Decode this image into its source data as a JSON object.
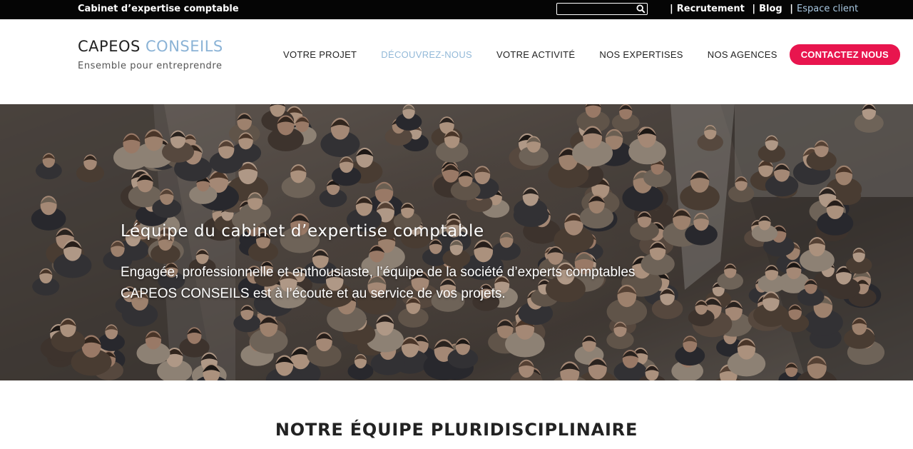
{
  "topbar": {
    "tagline": "Cabinet d’expertise comptable",
    "search": {
      "placeholder": ""
    },
    "links": [
      {
        "label": "Recrutement"
      },
      {
        "label": "Blog"
      },
      {
        "label": "Espace client"
      }
    ],
    "separator": "|"
  },
  "header": {
    "logo_part1": "CAPEOS",
    "logo_part2": "CONSEILS",
    "logo_tagline": "Ensemble pour entreprendre",
    "nav": [
      {
        "label": "VOTRE PROJET"
      },
      {
        "label": "DÉCOUVREZ-NOUS",
        "active": true
      },
      {
        "label": "VOTRE ACTIVITÉ"
      },
      {
        "label": "NOS EXPERTISES"
      },
      {
        "label": "NOS AGENCES"
      }
    ],
    "cta_label": "CONTACTEZ NOUS"
  },
  "hero": {
    "title": "Léquipe du cabinet d’expertise comptable",
    "text": "Engagée, professionnelle et enthousiaste, l’équipe de la société d’experts comptables CAPEOS CONSEILS est à l’écoute et au service de vos projets."
  },
  "section": {
    "title": "NOTRE ÉQUIPE PLURIDISCIPLINAIRE"
  },
  "colors": {
    "accent": "#e8154e",
    "logo_blue": "#8bb3d6",
    "active_nav": "#93b9d8",
    "client_link": "#a9c8e1",
    "topbar_bg": "#050505"
  },
  "icons": {
    "search": "search-icon"
  }
}
